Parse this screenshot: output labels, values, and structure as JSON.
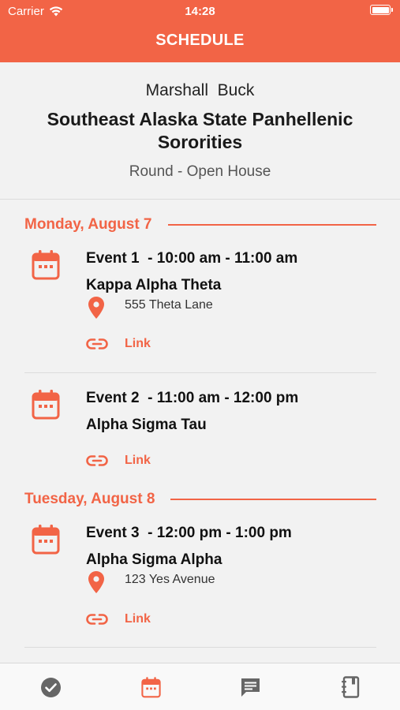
{
  "status": {
    "carrier": "Carrier",
    "time": "14:28"
  },
  "header": {
    "title": "SCHEDULE"
  },
  "profile": {
    "member_name": "Marshall  Buck",
    "org_name": "Southeast Alaska State Panhellenic Sororities",
    "round": "Round - Open House"
  },
  "days": [
    {
      "label": "Monday, August 7",
      "events": [
        {
          "title": "Event 1  - 10:00 am - 11:00 am",
          "org": "Kappa Alpha Theta",
          "address": "555 Theta Lane",
          "link_label": "Link"
        },
        {
          "title": "Event 2  - 11:00 am - 12:00 pm",
          "org": "Alpha Sigma Tau",
          "address": "",
          "link_label": "Link"
        }
      ]
    },
    {
      "label": "Tuesday, August 8",
      "events": [
        {
          "title": "Event 3  - 12:00 pm - 1:00 pm",
          "org": "Alpha Sigma Alpha",
          "address": "123 Yes Avenue",
          "link_label": "Link"
        }
      ]
    }
  ],
  "tabs": [
    {
      "icon": "checkmark-circle-icon",
      "active": false
    },
    {
      "icon": "calendar-icon",
      "active": true
    },
    {
      "icon": "chat-bubble-icon",
      "active": false
    },
    {
      "icon": "notebook-icon",
      "active": false
    }
  ],
  "colors": {
    "accent": "#f26446",
    "inactive_tab": "#666666",
    "background": "#f2f2f2"
  }
}
